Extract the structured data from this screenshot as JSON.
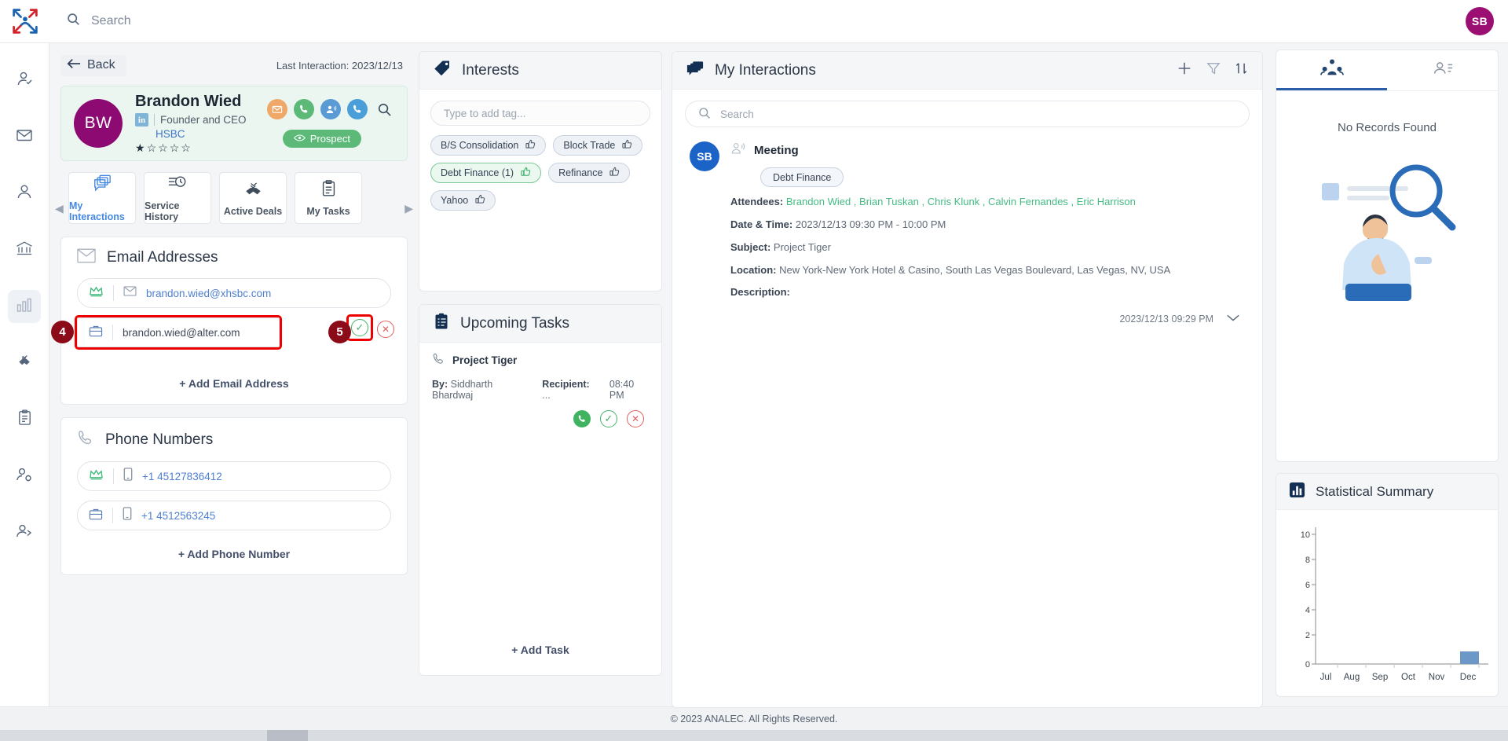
{
  "topbar": {
    "search_placeholder": "Search",
    "search_value": "",
    "user_initials": "SB",
    "search_icon": "search-icon",
    "logo_icon": "analec-logo-icon"
  },
  "rail": {
    "items": [
      {
        "icon": "user-check-icon",
        "name": "contacts-verify"
      },
      {
        "icon": "envelope-icon",
        "name": "mail"
      },
      {
        "icon": "user-icon",
        "name": "profile"
      },
      {
        "icon": "bank-icon",
        "name": "institutions"
      },
      {
        "icon": "analytics-icon",
        "name": "analytics",
        "active": true
      },
      {
        "icon": "handshake-check-icon",
        "name": "deals"
      },
      {
        "icon": "clipboard-list-icon",
        "name": "tasks"
      },
      {
        "icon": "user-gear-icon",
        "name": "user-settings"
      },
      {
        "icon": "user-share-icon",
        "name": "user-share"
      }
    ]
  },
  "profile": {
    "back_label": "Back",
    "last_interaction": "Last Interaction: 2023/12/13",
    "initials": "BW",
    "name": "Brandon Wied",
    "title": "Founder and CEO",
    "company": "HSBC",
    "linkedin_label": "in",
    "rating": 1,
    "rating_max": 5,
    "status_pill": "Prospect",
    "actions": [
      {
        "name": "email-action-icon",
        "glyph": "✉"
      },
      {
        "name": "call-action-icon",
        "glyph": "☎"
      },
      {
        "name": "meeting-action-icon",
        "glyph": "☺"
      },
      {
        "name": "phone-action-icon",
        "glyph": "☎"
      },
      {
        "name": "search-action-icon",
        "glyph": "⚲"
      }
    ]
  },
  "tabs": [
    {
      "label": "My Interactions",
      "icon": "chat-stack-icon",
      "active": true
    },
    {
      "label": "Service History",
      "icon": "history-clock-icon",
      "active": false
    },
    {
      "label": "Active Deals",
      "icon": "handshake-icon",
      "active": false
    },
    {
      "label": "My Tasks",
      "icon": "clipboard-icon",
      "active": false
    }
  ],
  "emails": {
    "title": "Email Addresses",
    "icon": "envelope-icon",
    "rows": [
      {
        "type_icon": "crown-icon",
        "channel_icon": "envelope-icon",
        "value": "brandon.wied@xhsbc.com",
        "editing": false
      },
      {
        "type_icon": "briefcase-icon",
        "channel_icon": "",
        "value": "brandon.wied@alter.com",
        "editing": true
      }
    ],
    "add_label": "+ Add Email Address",
    "confirm_icon": "check-circle-icon",
    "cancel_icon": "x-circle-icon",
    "badge_row": "4",
    "badge_confirm": "5"
  },
  "phones": {
    "title": "Phone Numbers",
    "icon": "phone-icon",
    "rows": [
      {
        "type_icon": "crown-icon",
        "channel_icon": "mobile-icon",
        "value": "+1 45127836412"
      },
      {
        "type_icon": "briefcase-icon",
        "channel_icon": "mobile-icon",
        "value": "+1 4512563245"
      }
    ],
    "add_label": "+ Add Phone Number"
  },
  "interests": {
    "title": "Interests",
    "icon": "tag-icon",
    "tag_input_placeholder": "Type to add tag...",
    "tags": [
      {
        "label": "B/S Consolidation",
        "liked": false
      },
      {
        "label": "Block Trade",
        "liked": false
      },
      {
        "label": "Debt Finance (1)",
        "liked": true
      },
      {
        "label": "Refinance",
        "liked": false
      },
      {
        "label": "Yahoo",
        "liked": false
      }
    ],
    "thumb_icon": "thumbs-up-icon"
  },
  "tasks": {
    "title": "Upcoming Tasks",
    "icon": "clipboard-tasks-icon",
    "items": [
      {
        "name": "Project Tiger",
        "type_icon": "phone-icon",
        "by_label": "By:",
        "by_value": "Siddharth Bhardwaj",
        "recipient_label": "Recipient:",
        "recipient_value": "...",
        "time": "08:40 PM"
      }
    ],
    "add_label": "+ Add Task"
  },
  "interactions": {
    "title": "My Interactions",
    "icon": "chat-stack-icon",
    "tools": [
      {
        "name": "add-interaction-button",
        "glyph": "+"
      },
      {
        "name": "filter-icon",
        "glyph": "∇"
      },
      {
        "name": "sort-icon",
        "glyph": "⇅"
      }
    ],
    "search_placeholder": "Search",
    "search_value": "",
    "items": [
      {
        "initials": "SB",
        "type": "Meeting",
        "type_icon": "meeting-icon",
        "tag": "Debt Finance",
        "attendees_label": "Attendees:",
        "attendees": "Brandon Wied , Brian Tuskan , Chris Klunk , Calvin Fernandes , Eric Harrison",
        "datetime_label": "Date & Time:",
        "datetime": "2023/12/13 09:30 PM - 10:00 PM",
        "subject_label": "Subject:",
        "subject": "Project Tiger",
        "location_label": "Location:",
        "location": "New York-New York Hotel & Casino, South Las Vegas Boulevard, Las Vegas, NV, USA",
        "description_label": "Description:",
        "description": "",
        "timestamp": "2023/12/13 09:29 PM",
        "expand_icon": "chevron-down-icon"
      }
    ]
  },
  "right_panel": {
    "tabs": [
      {
        "name": "relationship-tab",
        "icon": "relationship-icon",
        "active": true
      },
      {
        "name": "contacts-tab",
        "icon": "contact-card-icon",
        "active": false
      }
    ],
    "empty_title": "No Records Found",
    "empty_icon": "no-records-illustration"
  },
  "chart_data": {
    "type": "bar",
    "title": "Statistical Summary",
    "icon": "bar-chart-icon",
    "categories": [
      "Jul",
      "Aug",
      "Sep",
      "Oct",
      "Nov",
      "Dec"
    ],
    "values": [
      0,
      0,
      0,
      0,
      0,
      1
    ],
    "yticks": [
      0,
      2,
      4,
      6,
      8,
      10
    ],
    "ylim": [
      0,
      11
    ],
    "xlabel": "",
    "ylabel": "",
    "grid": false,
    "legend": "none",
    "bar_color": "#6c98c7"
  },
  "footer": {
    "text": "© 2023 ANALEC. All Rights Reserved."
  },
  "colors": {
    "accent": "#2a5ea8",
    "brand_red": "#d2232a",
    "green": "#5cb977",
    "avatar_purple": "#8c0a72",
    "highlight": "#ee0000"
  }
}
